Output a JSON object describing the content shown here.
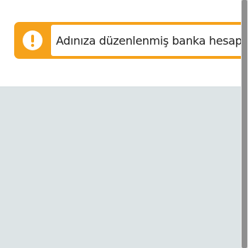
{
  "alert": {
    "icon": "exclamation-circle-icon",
    "icon_glyph": "!",
    "message": "Adınıza düzenlenmiş banka hesaplarınız",
    "accent_color": "#f6a21b"
  },
  "background": {
    "top_color": "#ffffff",
    "bottom_color": "#dde4e6"
  }
}
